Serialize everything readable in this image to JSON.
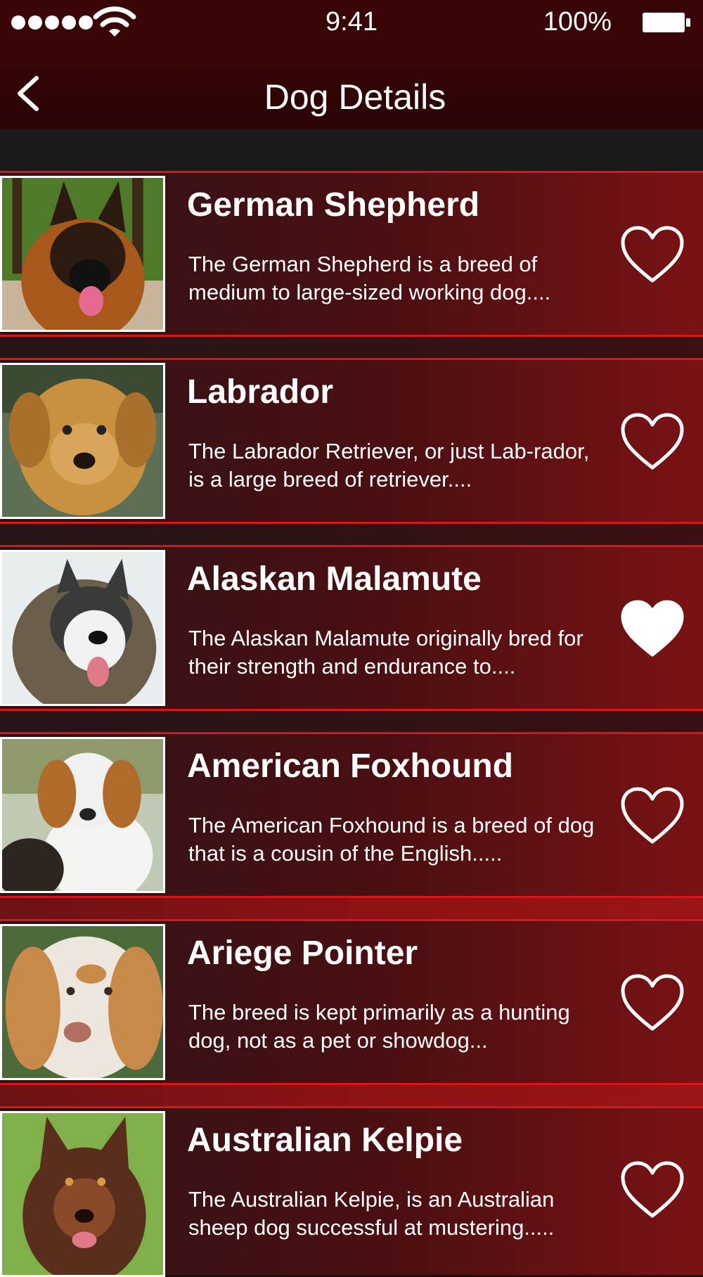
{
  "status_bar": {
    "time": "9:41",
    "battery": "100%"
  },
  "nav": {
    "title": "Dog Details"
  },
  "dogs": [
    {
      "name": "German Shepherd",
      "description": "The German Shepherd is a breed of medium to large-sized working dog....",
      "favorite": false
    },
    {
      "name": "Labrador",
      "description": "The Labrador Retriever, or just Lab-rador, is a large breed of retriever....",
      "favorite": false
    },
    {
      "name": "Alaskan Malamute",
      "description": "The Alaskan Malamute originally bred for their strength and endurance to....",
      "favorite": true
    },
    {
      "name": "American Foxhound",
      "description": "The American Foxhound is a breed of dog that is a cousin of the English.....",
      "favorite": false
    },
    {
      "name": "Ariege Pointer",
      "description": "The breed is kept primarily as a hunting dog, not as a pet or showdog...",
      "favorite": false
    },
    {
      "name": "Australian Kelpie",
      "description": "The Australian Kelpie, is an Australian sheep dog successful at mustering.....",
      "favorite": false
    }
  ],
  "icons": {
    "back": "chevron-left-icon",
    "favorite": "heart-icon"
  }
}
